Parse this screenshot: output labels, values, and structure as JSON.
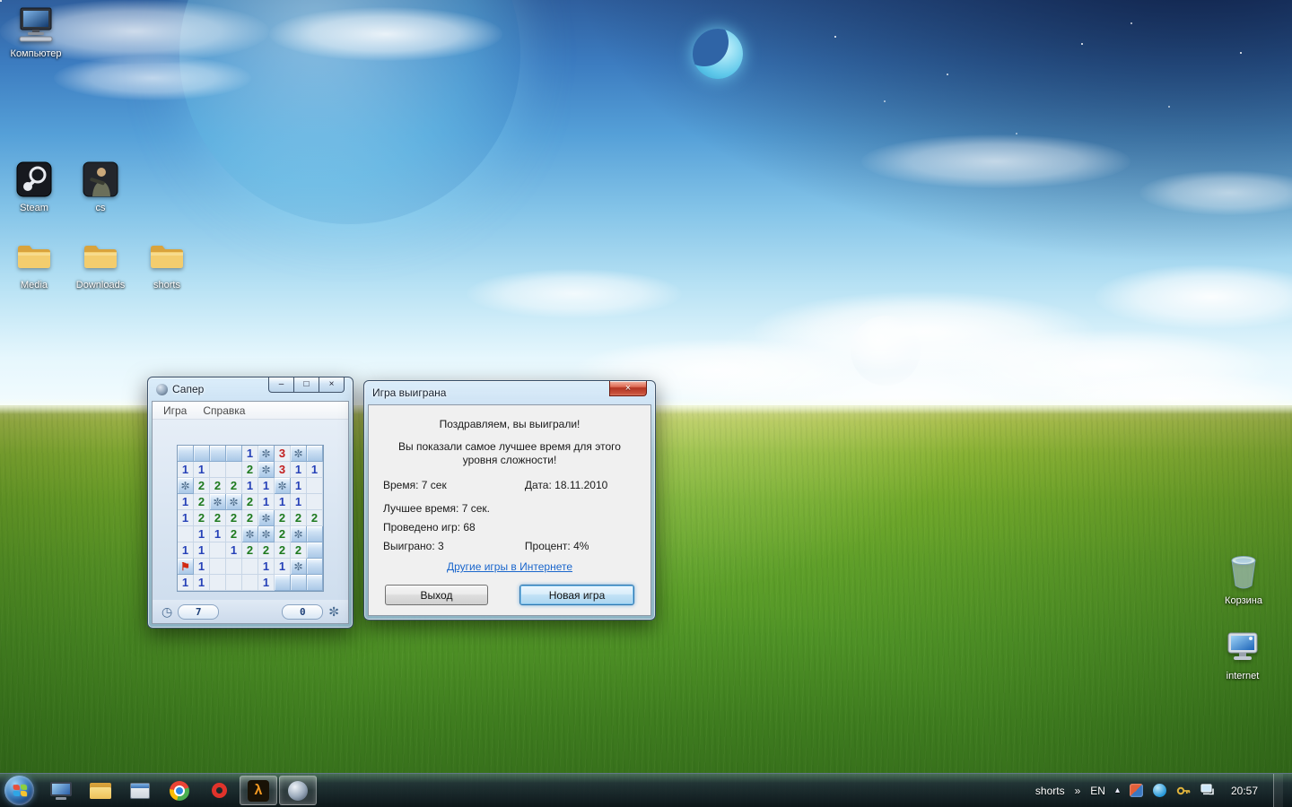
{
  "window_controls": {
    "minimize": "–",
    "maximize": "□",
    "close": "×"
  },
  "desktop": {
    "icons": [
      {
        "label": "Компьютер",
        "icon": "computer-icon"
      },
      {
        "label": "Steam",
        "icon": "steam-icon"
      },
      {
        "label": "cs",
        "icon": "counter-strike-icon"
      },
      {
        "label": "Media",
        "icon": "folder-icon"
      },
      {
        "label": "Downloads",
        "icon": "folder-icon"
      },
      {
        "label": "shorts",
        "icon": "folder-icon"
      },
      {
        "label": "Корзина",
        "icon": "recycle-bin-icon"
      },
      {
        "label": "internet",
        "icon": "monitor-icon"
      }
    ]
  },
  "minesweeper": {
    "title": "Сапер",
    "menu": [
      "Игра",
      "Справка"
    ],
    "timer": "7",
    "mines_left": "0",
    "glyphs": {
      "mine": "✼",
      "flag": "⚑",
      "clock": "◷"
    },
    "board": [
      [
        "U",
        "U",
        "U",
        "U",
        "1",
        "M",
        "3",
        "M",
        "U"
      ],
      [
        "1",
        "1",
        "0",
        "0",
        "2",
        "M",
        "3",
        "1",
        "1"
      ],
      [
        "M",
        "2",
        "2",
        "2",
        "1",
        "1",
        "M",
        "1",
        "0"
      ],
      [
        "1",
        "2",
        "M",
        "M",
        "2",
        "1",
        "1",
        "1",
        "0"
      ],
      [
        "1",
        "2",
        "2",
        "2",
        "2",
        "M",
        "2",
        "2",
        "2"
      ],
      [
        "0",
        "1",
        "1",
        "2",
        "M",
        "M",
        "2",
        "M",
        "U"
      ],
      [
        "1",
        "1",
        "0",
        "1",
        "2",
        "2",
        "2",
        "2",
        "U"
      ],
      [
        "F",
        "1",
        "0",
        "0",
        "0",
        "1",
        "1",
        "M",
        "U"
      ],
      [
        "1",
        "1",
        "0",
        "0",
        "0",
        "1",
        "U",
        "U",
        "U"
      ]
    ]
  },
  "dialog": {
    "title": "Игра выиграна",
    "congrats": "Поздравляем, вы выиграли!",
    "message": "Вы показали самое лучшее время для этого уровня сложности!",
    "stats": {
      "time": "Время: 7 сек",
      "date": "Дата: 18.11.2010",
      "best_time": "Лучшее время: 7 сек.",
      "games_played": "Проведено игр: 68",
      "won": "Выиграно: 3",
      "percent": "Процент: 4%"
    },
    "link": "Другие игры в Интернете",
    "buttons": {
      "exit": "Выход",
      "new_game": "Новая игра"
    }
  },
  "taskbar": {
    "glyphs": {
      "half_life": "λ",
      "hidden_icons": "▴",
      "chevron": "»"
    },
    "tray": {
      "toolbar": "shorts",
      "language": "EN",
      "time": "20:57"
    }
  },
  "colors": {
    "numbers": {
      "1": "#2742b8",
      "2": "#1e7a1e",
      "3": "#c21f1f",
      "4": "#1a237e"
    },
    "link": "#1a66cc",
    "dialog_close": "#b23523"
  }
}
